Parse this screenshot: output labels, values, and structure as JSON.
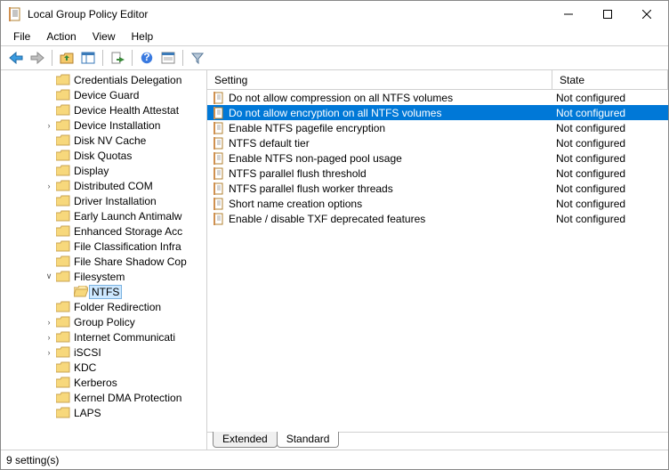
{
  "window": {
    "title": "Local Group Policy Editor"
  },
  "menubar": [
    "File",
    "Action",
    "View",
    "Help"
  ],
  "tree": {
    "items": [
      {
        "label": "Credentials Delegation",
        "toggle": null,
        "selected": false,
        "child": false
      },
      {
        "label": "Device Guard",
        "toggle": null,
        "selected": false,
        "child": false
      },
      {
        "label": "Device Health Attestat",
        "toggle": null,
        "selected": false,
        "child": false
      },
      {
        "label": "Device Installation",
        "toggle": "collapsed",
        "selected": false,
        "child": false
      },
      {
        "label": "Disk NV Cache",
        "toggle": null,
        "selected": false,
        "child": false
      },
      {
        "label": "Disk Quotas",
        "toggle": null,
        "selected": false,
        "child": false
      },
      {
        "label": "Display",
        "toggle": null,
        "selected": false,
        "child": false
      },
      {
        "label": "Distributed COM",
        "toggle": "collapsed",
        "selected": false,
        "child": false
      },
      {
        "label": "Driver Installation",
        "toggle": null,
        "selected": false,
        "child": false
      },
      {
        "label": "Early Launch Antimalw",
        "toggle": null,
        "selected": false,
        "child": false
      },
      {
        "label": "Enhanced Storage Acc",
        "toggle": null,
        "selected": false,
        "child": false
      },
      {
        "label": "File Classification Infra",
        "toggle": null,
        "selected": false,
        "child": false
      },
      {
        "label": "File Share Shadow Cop",
        "toggle": null,
        "selected": false,
        "child": false
      },
      {
        "label": "Filesystem",
        "toggle": "expanded",
        "selected": false,
        "child": false
      },
      {
        "label": "NTFS",
        "toggle": null,
        "selected": true,
        "child": true
      },
      {
        "label": "Folder Redirection",
        "toggle": null,
        "selected": false,
        "child": false
      },
      {
        "label": "Group Policy",
        "toggle": "collapsed",
        "selected": false,
        "child": false
      },
      {
        "label": "Internet Communicati",
        "toggle": "collapsed",
        "selected": false,
        "child": false
      },
      {
        "label": "iSCSI",
        "toggle": "collapsed",
        "selected": false,
        "child": false
      },
      {
        "label": "KDC",
        "toggle": null,
        "selected": false,
        "child": false
      },
      {
        "label": "Kerberos",
        "toggle": null,
        "selected": false,
        "child": false
      },
      {
        "label": "Kernel DMA Protection",
        "toggle": null,
        "selected": false,
        "child": false
      },
      {
        "label": "LAPS",
        "toggle": null,
        "selected": false,
        "child": false
      }
    ]
  },
  "list": {
    "headers": {
      "setting": "Setting",
      "state": "State"
    },
    "rows": [
      {
        "setting": "Do not allow compression on all NTFS volumes",
        "state": "Not configured",
        "selected": false
      },
      {
        "setting": "Do not allow encryption on all NTFS volumes",
        "state": "Not configured",
        "selected": true
      },
      {
        "setting": "Enable NTFS pagefile encryption",
        "state": "Not configured",
        "selected": false
      },
      {
        "setting": "NTFS default tier",
        "state": "Not configured",
        "selected": false
      },
      {
        "setting": "Enable NTFS non-paged pool usage",
        "state": "Not configured",
        "selected": false
      },
      {
        "setting": "NTFS parallel flush threshold",
        "state": "Not configured",
        "selected": false
      },
      {
        "setting": "NTFS parallel flush worker threads",
        "state": "Not configured",
        "selected": false
      },
      {
        "setting": "Short name creation options",
        "state": "Not configured",
        "selected": false
      },
      {
        "setting": "Enable / disable TXF deprecated features",
        "state": "Not configured",
        "selected": false
      }
    ]
  },
  "tabs": {
    "extended": "Extended",
    "standard": "Standard"
  },
  "statusbar": {
    "text": "9 setting(s)"
  }
}
